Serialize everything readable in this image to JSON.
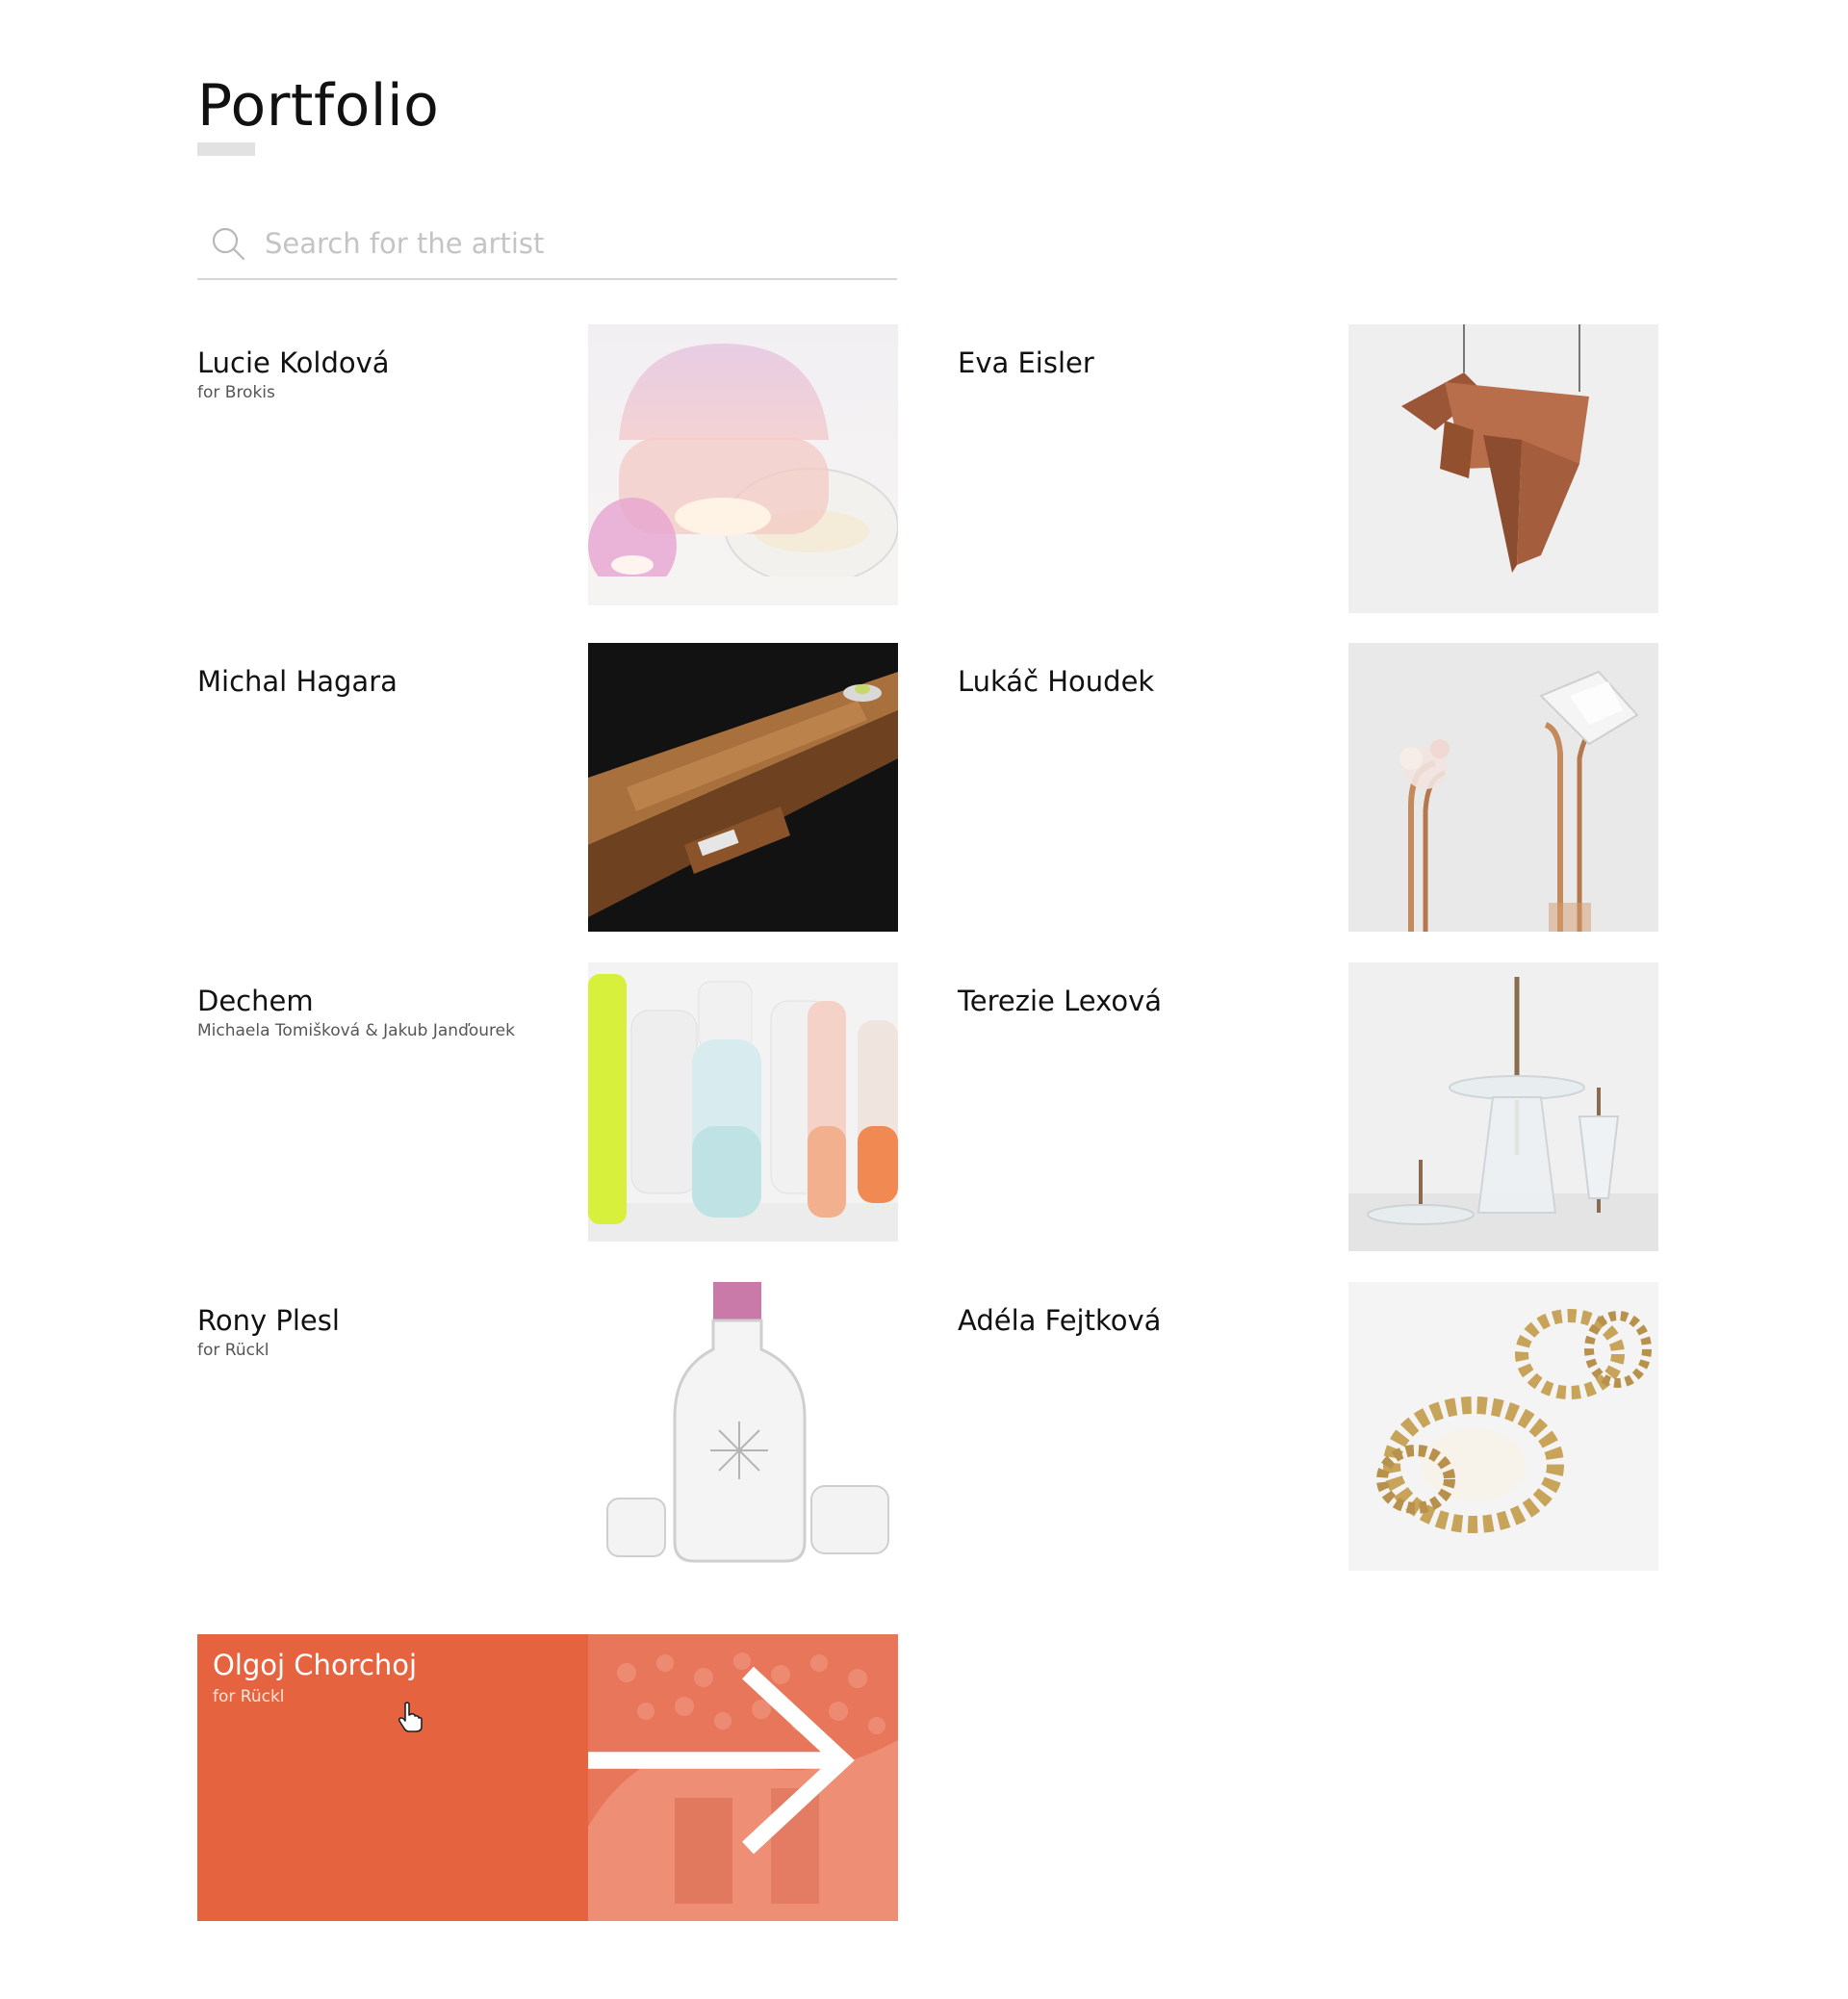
{
  "page": {
    "title": "Portfolio"
  },
  "search": {
    "placeholder": "Search for the artist",
    "value": ""
  },
  "artists": [
    {
      "name": "Lucie Koldová",
      "subtitle": "for Brokis",
      "image": "pink-glass-lamps"
    },
    {
      "name": "Eva Eisler",
      "subtitle": "",
      "image": "wooden-pendant"
    },
    {
      "name": "Michal Hagara",
      "subtitle": "",
      "image": "wooden-bench"
    },
    {
      "name": "Lukáč Houdek",
      "subtitle": "",
      "image": "crystal-sculptures"
    },
    {
      "name": "Dechem",
      "subtitle": "Michaela Tomišková & Jakub Janďourek",
      "image": "colored-glass-vases"
    },
    {
      "name": "Terezie Lexová",
      "subtitle": "",
      "image": "glass-stands"
    },
    {
      "name": "Rony Plesl",
      "subtitle": "for Rückl",
      "image": "glass-decanter"
    },
    {
      "name": "Adéla Fejtková",
      "subtitle": "",
      "image": "gold-rings"
    },
    {
      "name": "Olgoj Chorchoj",
      "subtitle": "for Rückl",
      "image": "glass-installation",
      "highlighted": true
    }
  ],
  "colors": {
    "accent": "#e5643f",
    "divider": "#d6d6d6",
    "underline": "#e2e2e2",
    "placeholder": "#c4c4c4"
  }
}
